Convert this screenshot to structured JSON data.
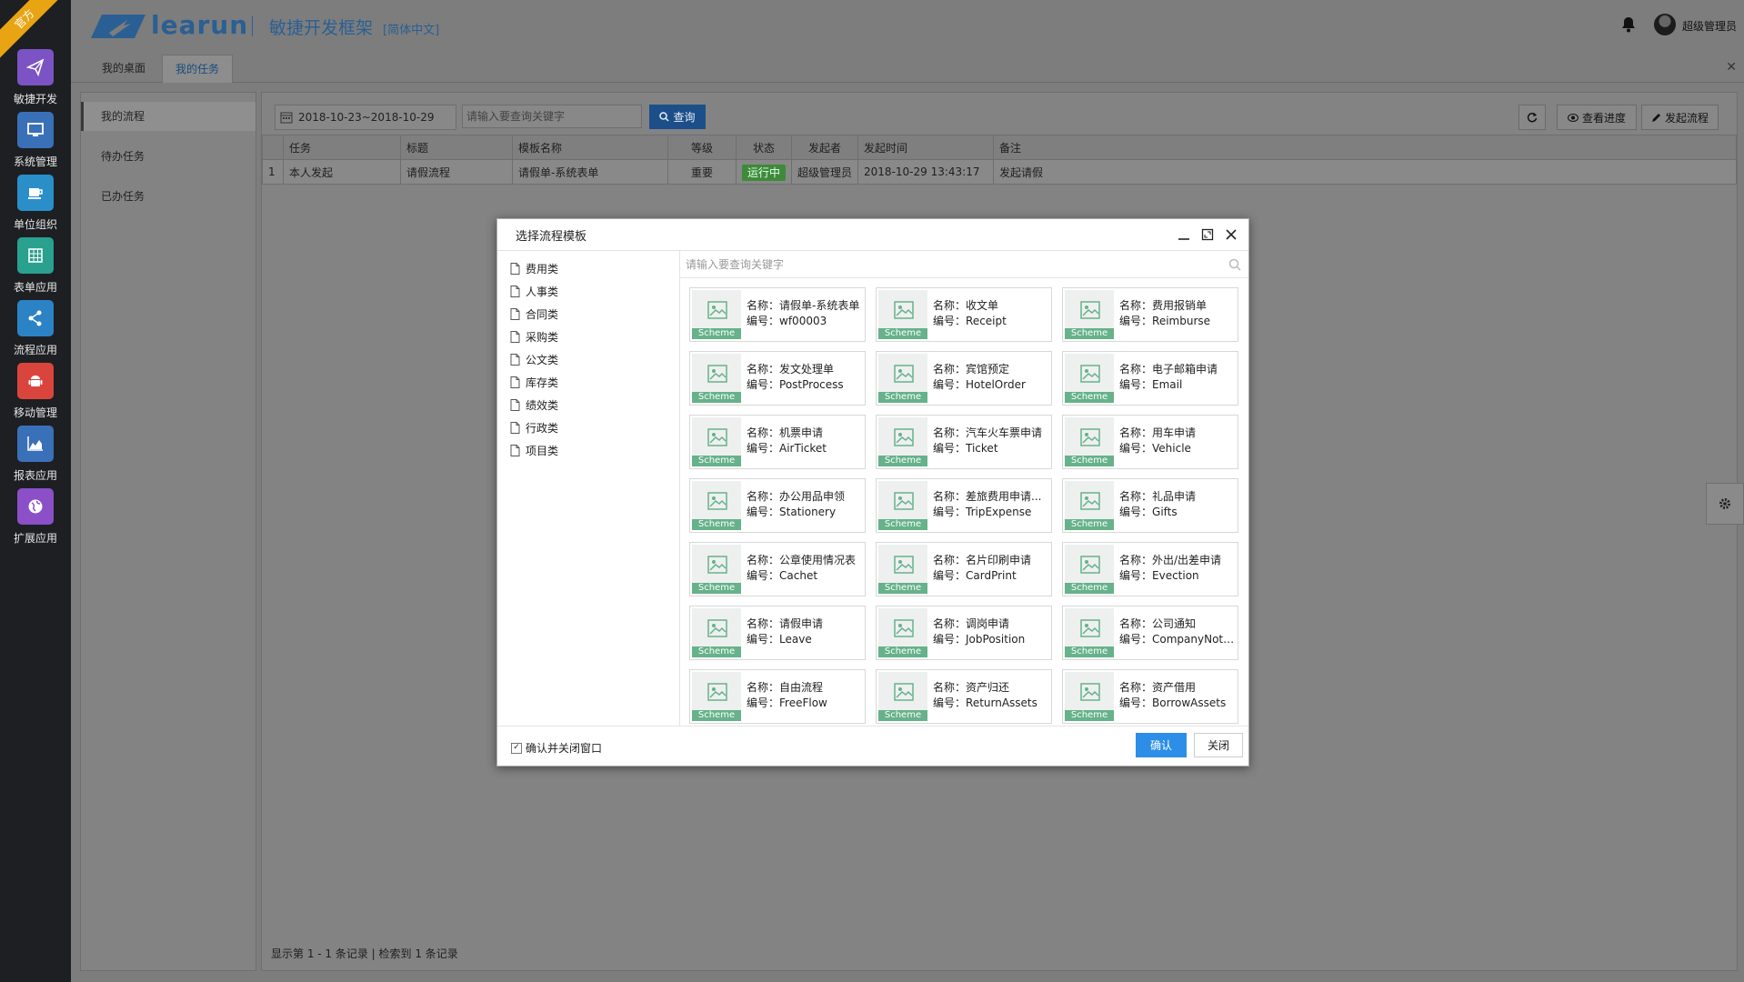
{
  "brand": {
    "ribbon": "官方",
    "logo_text": "learun",
    "subtitle": "敏捷开发框架",
    "lang": "[简体中文]",
    "logo_color": "#2a5f93"
  },
  "user": {
    "name": "超级管理员"
  },
  "sidebar": {
    "items": [
      {
        "label": "敏捷开发",
        "icon": "paper-plane-icon",
        "color": "#7b53c4"
      },
      {
        "label": "系统管理",
        "icon": "monitor-icon",
        "color": "#3a70b8"
      },
      {
        "label": "单位组织",
        "icon": "coffee-icon",
        "color": "#2a8fc9"
      },
      {
        "label": "表单应用",
        "icon": "table-icon",
        "color": "#2aa08f"
      },
      {
        "label": "流程应用",
        "icon": "share-icon",
        "color": "#2b83c5"
      },
      {
        "label": "移动管理",
        "icon": "android-icon",
        "color": "#d9453d"
      },
      {
        "label": "报表应用",
        "icon": "area-chart-icon",
        "color": "#3a70b8"
      },
      {
        "label": "扩展应用",
        "icon": "globe-icon",
        "color": "#8b4fc7"
      }
    ]
  },
  "tabs": [
    {
      "label": "我的桌面",
      "active": false
    },
    {
      "label": "我的任务",
      "active": true
    }
  ],
  "left_menu": [
    "我的流程",
    "待办任务",
    "已办任务"
  ],
  "toolbar": {
    "date_range": "2018-10-23~2018-10-29",
    "search_placeholder": "请输入要查询关键字",
    "query_label": "查询",
    "refresh_icon": "refresh-icon",
    "progress_label": "查看进度",
    "start_label": "发起流程"
  },
  "grid": {
    "columns": [
      "",
      "任务",
      "标题",
      "模板名称",
      "等级",
      "状态",
      "发起者",
      "发起时间",
      "备注"
    ],
    "rows": [
      {
        "no": "1",
        "task": "本人发起",
        "title": "请假流程",
        "template": "请假单-系统表单",
        "level": "重要",
        "status": "运行中",
        "initiator": "超级管理员",
        "time": "2018-10-29 13:43:17",
        "note": "发起请假"
      }
    ],
    "footer": "显示第 1 - 1 条记录 | 检索到 1 条记录"
  },
  "dialog": {
    "title": "选择流程模板",
    "search_placeholder": "请输入要查询关键字",
    "categories": [
      "费用类",
      "人事类",
      "合同类",
      "采购类",
      "公文类",
      "库存类",
      "绩效类",
      "行政类",
      "项目类"
    ],
    "thumb_tag": "Scheme",
    "name_prefix": "名称：",
    "code_prefix": "编号：",
    "templates": [
      {
        "name": "请假单-系统表单",
        "code": "wf00003"
      },
      {
        "name": "收文单",
        "code": "Receipt"
      },
      {
        "name": "费用报销单",
        "code": "Reimburse"
      },
      {
        "name": "发文处理单",
        "code": "PostProcess"
      },
      {
        "name": "宾馆预定",
        "code": "HotelOrder"
      },
      {
        "name": "电子邮箱申请",
        "code": "Email"
      },
      {
        "name": "机票申请",
        "code": "AirTicket"
      },
      {
        "name": "汽车火车票申请",
        "code": "Ticket"
      },
      {
        "name": "用车申请",
        "code": "Vehicle"
      },
      {
        "name": "办公用品申领",
        "code": "Stationery"
      },
      {
        "name": "差旅费用申请...",
        "code": "TripExpense"
      },
      {
        "name": "礼品申请",
        "code": "Gifts"
      },
      {
        "name": "公章使用情况表",
        "code": "Cachet"
      },
      {
        "name": "名片印刷申请",
        "code": "CardPrint"
      },
      {
        "name": "外出/出差申请",
        "code": "Evection"
      },
      {
        "name": "请假申请",
        "code": "Leave"
      },
      {
        "name": "调岗申请",
        "code": "JobPosition"
      },
      {
        "name": "公司通知",
        "code": "CompanyNoti..."
      },
      {
        "name": "自由流程",
        "code": "FreeFlow"
      },
      {
        "name": "资产归还",
        "code": "ReturnAssets"
      },
      {
        "name": "资产借用",
        "code": "BorrowAssets"
      }
    ],
    "confirm_close_label": "确认并关闭窗口",
    "confirm_checked": true,
    "ok_label": "确认",
    "close_label": "关闭"
  }
}
